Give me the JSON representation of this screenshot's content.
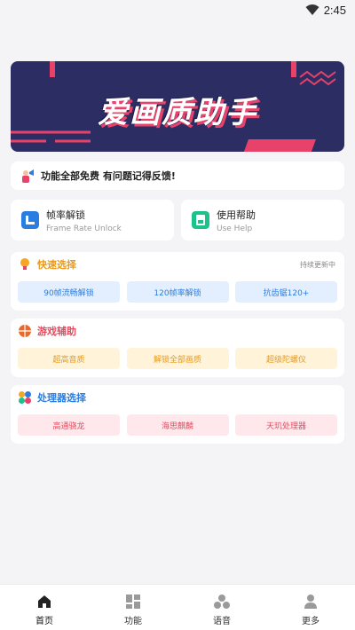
{
  "status": {
    "time": "2:45"
  },
  "banner": {
    "title": "爱画质助手"
  },
  "notice": {
    "text": "功能全部免费 有问题记得反馈!"
  },
  "features": [
    {
      "title": "帧率解锁",
      "subtitle": "Frame Rate Unlock",
      "icon": "frame-rate-icon"
    },
    {
      "title": "使用帮助",
      "subtitle": "Use Help",
      "icon": "help-doc-icon"
    }
  ],
  "quick": {
    "title": "快速选择",
    "note": "持续更新中",
    "icon": "lightbulb-icon",
    "buttons": [
      "90帧流畅解锁",
      "120帧率解锁",
      "抗齿锯120+"
    ]
  },
  "game": {
    "title": "游戏辅助",
    "icon": "game-ball-icon",
    "buttons": [
      "超高音质",
      "解锁全部画质",
      "超级陀螺仪"
    ]
  },
  "cpu": {
    "title": "处理器选择",
    "icon": "processor-icon",
    "buttons": [
      "高通骁龙",
      "海思麒麟",
      "天玑处理器"
    ]
  },
  "nav": [
    {
      "label": "首页",
      "icon": "home-icon"
    },
    {
      "label": "功能",
      "icon": "grid-icon"
    },
    {
      "label": "语音",
      "icon": "voice-icon"
    },
    {
      "label": "更多",
      "icon": "more-icon"
    }
  ],
  "colors": {
    "banner_bg": "#2b2d63",
    "accent_pink": "#e8426b",
    "accent_blue": "#2a7de1",
    "accent_yellow": "#e89a1a"
  }
}
